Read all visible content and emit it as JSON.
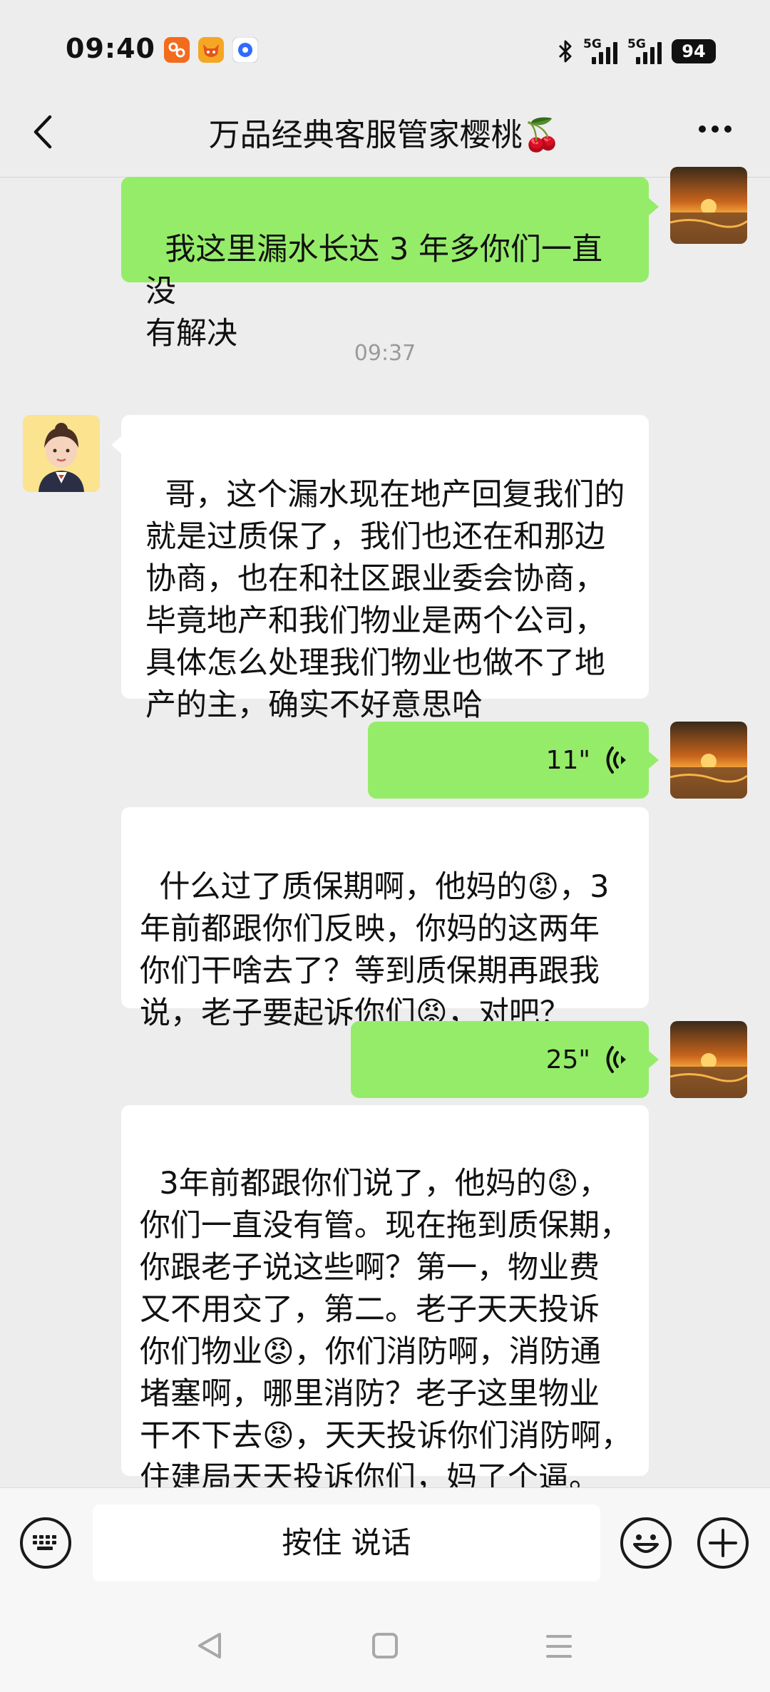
{
  "status_bar": {
    "time": "09:40",
    "network1": "5G",
    "network2": "5G",
    "battery": "94"
  },
  "nav": {
    "title": "万品经典客服管家樱桃🍒"
  },
  "messages": [
    {
      "side": "right",
      "type": "text",
      "text": "我这里漏水长达 3 年多你们一直没\n有解决"
    },
    {
      "type": "time",
      "text": "09:37"
    },
    {
      "side": "left",
      "type": "text",
      "text": "哥，这个漏水现在地产回复我们的\n就是过质保了，我们也还在和那边\n协商，也在和社区跟业委会协商，\n毕竟地产和我们物业是两个公司，\n具体怎么处理我们物业也做不了地\n产的主，确实不好意思哈"
    },
    {
      "side": "right",
      "type": "voice",
      "duration": "11\""
    },
    {
      "type": "transcript",
      "text": "什么过了质保期啊，他妈的😡，3\n年前都跟你们反映，你妈的这两年\n你们干啥去了？等到质保期再跟我\n说，老子要起诉你们😡，对吧？"
    },
    {
      "side": "right",
      "type": "voice",
      "duration": "25\""
    },
    {
      "type": "transcript",
      "text": "3年前都跟你们说了，他妈的😡，\n你们一直没有管。现在拖到质保期，\n你跟老子说这些啊？第一，物业费\n又不用交了，第二。老子天天投诉\n你们物业😡，你们消防啊，消防通\n堵塞啊，哪里消防？老子这里物业\n干不下去😡，天天投诉你们消防啊，\n住建局天天投诉你们，妈了个逼。"
    }
  ],
  "input": {
    "talk_label": "按住 说话"
  },
  "icons": {
    "back": "chevron-left-icon",
    "more": "more-dots-icon",
    "keyboard": "keyboard-icon",
    "emoji": "emoji-icon",
    "plus": "plus-icon",
    "bluetooth": "bluetooth-icon"
  },
  "colors": {
    "sent_bubble": "#95ec69",
    "received_bubble": "#ffffff",
    "background": "#ededed"
  }
}
